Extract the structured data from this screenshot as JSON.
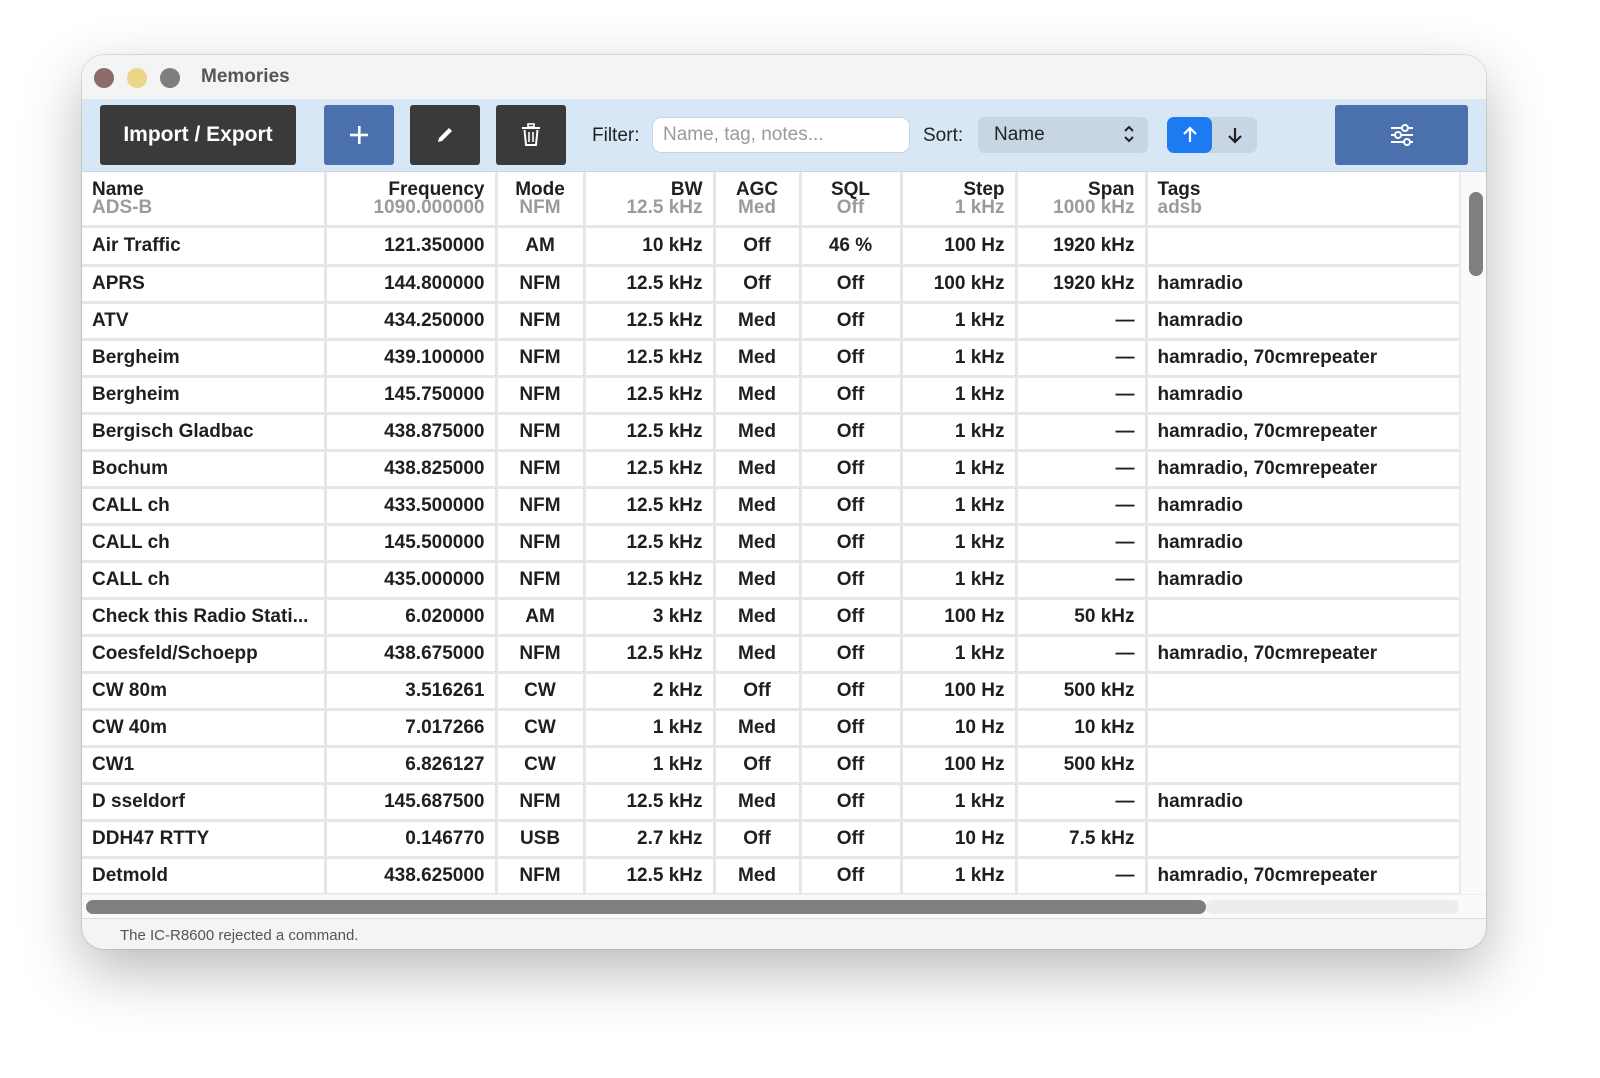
{
  "window": {
    "title": "Memories"
  },
  "toolbar": {
    "import_export_label": "Import / Export",
    "filter_label": "Filter:",
    "filter_placeholder": "Name, tag, notes...",
    "filter_value": "",
    "sort_label": "Sort:",
    "sort_value": "Name",
    "icons": {
      "add": "plus-icon",
      "edit": "pencil-icon",
      "delete": "trash-icon",
      "sort_asc": "arrow-up-icon",
      "sort_desc": "arrow-down-icon",
      "settings": "sliders-icon"
    },
    "sort_direction": "ascending"
  },
  "table": {
    "columns": [
      "Name",
      "Frequency",
      "Mode",
      "BW",
      "AGC",
      "SQL",
      "Step",
      "Span",
      "Tags"
    ],
    "partial_top_row": [
      "ADS-B",
      "1090.000000",
      "NFM",
      "12.5 kHz",
      "Med",
      "Off",
      "1 kHz",
      "1000 kHz",
      "adsb"
    ],
    "rows": [
      [
        "Air Traffic",
        "121.350000",
        "AM",
        "10 kHz",
        "Off",
        "46 %",
        "100 Hz",
        "1920 kHz",
        ""
      ],
      [
        "APRS",
        "144.800000",
        "NFM",
        "12.5 kHz",
        "Off",
        "Off",
        "100 kHz",
        "1920 kHz",
        "hamradio"
      ],
      [
        "ATV",
        "434.250000",
        "NFM",
        "12.5 kHz",
        "Med",
        "Off",
        "1 kHz",
        "—",
        "hamradio"
      ],
      [
        "Bergheim",
        "439.100000",
        "NFM",
        "12.5 kHz",
        "Med",
        "Off",
        "1 kHz",
        "—",
        "hamradio, 70cmrepeater"
      ],
      [
        "Bergheim",
        "145.750000",
        "NFM",
        "12.5 kHz",
        "Med",
        "Off",
        "1 kHz",
        "—",
        "hamradio"
      ],
      [
        "Bergisch Gladbac",
        "438.875000",
        "NFM",
        "12.5 kHz",
        "Med",
        "Off",
        "1 kHz",
        "—",
        "hamradio, 70cmrepeater"
      ],
      [
        "Bochum",
        "438.825000",
        "NFM",
        "12.5 kHz",
        "Med",
        "Off",
        "1 kHz",
        "—",
        "hamradio, 70cmrepeater"
      ],
      [
        "CALL ch",
        "433.500000",
        "NFM",
        "12.5 kHz",
        "Med",
        "Off",
        "1 kHz",
        "—",
        "hamradio"
      ],
      [
        "CALL ch",
        "145.500000",
        "NFM",
        "12.5 kHz",
        "Med",
        "Off",
        "1 kHz",
        "—",
        "hamradio"
      ],
      [
        "CALL ch",
        "435.000000",
        "NFM",
        "12.5 kHz",
        "Med",
        "Off",
        "1 kHz",
        "—",
        "hamradio"
      ],
      [
        "Check this Radio Stati...",
        "6.020000",
        "AM",
        "3 kHz",
        "Med",
        "Off",
        "100 Hz",
        "50 kHz",
        ""
      ],
      [
        "Coesfeld/Schoepp",
        "438.675000",
        "NFM",
        "12.5 kHz",
        "Med",
        "Off",
        "1 kHz",
        "—",
        "hamradio, 70cmrepeater"
      ],
      [
        "CW  80m",
        "3.516261",
        "CW",
        "2 kHz",
        "Off",
        "Off",
        "100 Hz",
        "500 kHz",
        ""
      ],
      [
        "CW 40m",
        "7.017266",
        "CW",
        "1 kHz",
        "Med",
        "Off",
        "10 Hz",
        "10 kHz",
        ""
      ],
      [
        "CW1",
        "6.826127",
        "CW",
        "1 kHz",
        "Off",
        "Off",
        "100 Hz",
        "500 kHz",
        ""
      ],
      [
        "D sseldorf",
        "145.687500",
        "NFM",
        "12.5 kHz",
        "Med",
        "Off",
        "1 kHz",
        "—",
        "hamradio"
      ],
      [
        "DDH47 RTTY",
        "0.146770",
        "USB",
        "2.7 kHz",
        "Off",
        "Off",
        "10 Hz",
        "7.5 kHz",
        ""
      ],
      [
        "Detmold",
        "438.625000",
        "NFM",
        "12.5 kHz",
        "Med",
        "Off",
        "1 kHz",
        "—",
        "hamradio, 70cmrepeater"
      ]
    ]
  },
  "status": {
    "message": "The IC-R8600 rejected a command."
  }
}
